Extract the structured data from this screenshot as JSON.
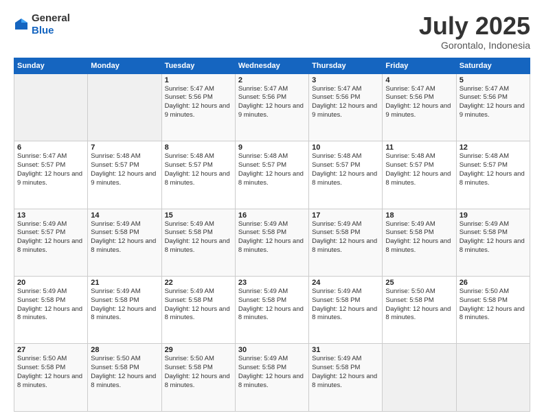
{
  "logo": {
    "general": "General",
    "blue": "Blue"
  },
  "title": "July 2025",
  "location": "Gorontalo, Indonesia",
  "header_days": [
    "Sunday",
    "Monday",
    "Tuesday",
    "Wednesday",
    "Thursday",
    "Friday",
    "Saturday"
  ],
  "weeks": [
    [
      {
        "day": "",
        "info": ""
      },
      {
        "day": "",
        "info": ""
      },
      {
        "day": "1",
        "info": "Sunrise: 5:47 AM\nSunset: 5:56 PM\nDaylight: 12 hours\nand 9 minutes."
      },
      {
        "day": "2",
        "info": "Sunrise: 5:47 AM\nSunset: 5:56 PM\nDaylight: 12 hours\nand 9 minutes."
      },
      {
        "day": "3",
        "info": "Sunrise: 5:47 AM\nSunset: 5:56 PM\nDaylight: 12 hours\nand 9 minutes."
      },
      {
        "day": "4",
        "info": "Sunrise: 5:47 AM\nSunset: 5:56 PM\nDaylight: 12 hours\nand 9 minutes."
      },
      {
        "day": "5",
        "info": "Sunrise: 5:47 AM\nSunset: 5:56 PM\nDaylight: 12 hours\nand 9 minutes."
      }
    ],
    [
      {
        "day": "6",
        "info": "Sunrise: 5:47 AM\nSunset: 5:57 PM\nDaylight: 12 hours\nand 9 minutes."
      },
      {
        "day": "7",
        "info": "Sunrise: 5:48 AM\nSunset: 5:57 PM\nDaylight: 12 hours\nand 9 minutes."
      },
      {
        "day": "8",
        "info": "Sunrise: 5:48 AM\nSunset: 5:57 PM\nDaylight: 12 hours\nand 8 minutes."
      },
      {
        "day": "9",
        "info": "Sunrise: 5:48 AM\nSunset: 5:57 PM\nDaylight: 12 hours\nand 8 minutes."
      },
      {
        "day": "10",
        "info": "Sunrise: 5:48 AM\nSunset: 5:57 PM\nDaylight: 12 hours\nand 8 minutes."
      },
      {
        "day": "11",
        "info": "Sunrise: 5:48 AM\nSunset: 5:57 PM\nDaylight: 12 hours\nand 8 minutes."
      },
      {
        "day": "12",
        "info": "Sunrise: 5:48 AM\nSunset: 5:57 PM\nDaylight: 12 hours\nand 8 minutes."
      }
    ],
    [
      {
        "day": "13",
        "info": "Sunrise: 5:49 AM\nSunset: 5:57 PM\nDaylight: 12 hours\nand 8 minutes."
      },
      {
        "day": "14",
        "info": "Sunrise: 5:49 AM\nSunset: 5:58 PM\nDaylight: 12 hours\nand 8 minutes."
      },
      {
        "day": "15",
        "info": "Sunrise: 5:49 AM\nSunset: 5:58 PM\nDaylight: 12 hours\nand 8 minutes."
      },
      {
        "day": "16",
        "info": "Sunrise: 5:49 AM\nSunset: 5:58 PM\nDaylight: 12 hours\nand 8 minutes."
      },
      {
        "day": "17",
        "info": "Sunrise: 5:49 AM\nSunset: 5:58 PM\nDaylight: 12 hours\nand 8 minutes."
      },
      {
        "day": "18",
        "info": "Sunrise: 5:49 AM\nSunset: 5:58 PM\nDaylight: 12 hours\nand 8 minutes."
      },
      {
        "day": "19",
        "info": "Sunrise: 5:49 AM\nSunset: 5:58 PM\nDaylight: 12 hours\nand 8 minutes."
      }
    ],
    [
      {
        "day": "20",
        "info": "Sunrise: 5:49 AM\nSunset: 5:58 PM\nDaylight: 12 hours\nand 8 minutes."
      },
      {
        "day": "21",
        "info": "Sunrise: 5:49 AM\nSunset: 5:58 PM\nDaylight: 12 hours\nand 8 minutes."
      },
      {
        "day": "22",
        "info": "Sunrise: 5:49 AM\nSunset: 5:58 PM\nDaylight: 12 hours\nand 8 minutes."
      },
      {
        "day": "23",
        "info": "Sunrise: 5:49 AM\nSunset: 5:58 PM\nDaylight: 12 hours\nand 8 minutes."
      },
      {
        "day": "24",
        "info": "Sunrise: 5:49 AM\nSunset: 5:58 PM\nDaylight: 12 hours\nand 8 minutes."
      },
      {
        "day": "25",
        "info": "Sunrise: 5:50 AM\nSunset: 5:58 PM\nDaylight: 12 hours\nand 8 minutes."
      },
      {
        "day": "26",
        "info": "Sunrise: 5:50 AM\nSunset: 5:58 PM\nDaylight: 12 hours\nand 8 minutes."
      }
    ],
    [
      {
        "day": "27",
        "info": "Sunrise: 5:50 AM\nSunset: 5:58 PM\nDaylight: 12 hours\nand 8 minutes."
      },
      {
        "day": "28",
        "info": "Sunrise: 5:50 AM\nSunset: 5:58 PM\nDaylight: 12 hours\nand 8 minutes."
      },
      {
        "day": "29",
        "info": "Sunrise: 5:50 AM\nSunset: 5:58 PM\nDaylight: 12 hours\nand 8 minutes."
      },
      {
        "day": "30",
        "info": "Sunrise: 5:49 AM\nSunset: 5:58 PM\nDaylight: 12 hours\nand 8 minutes."
      },
      {
        "day": "31",
        "info": "Sunrise: 5:49 AM\nSunset: 5:58 PM\nDaylight: 12 hours\nand 8 minutes."
      },
      {
        "day": "",
        "info": ""
      },
      {
        "day": "",
        "info": ""
      }
    ]
  ]
}
